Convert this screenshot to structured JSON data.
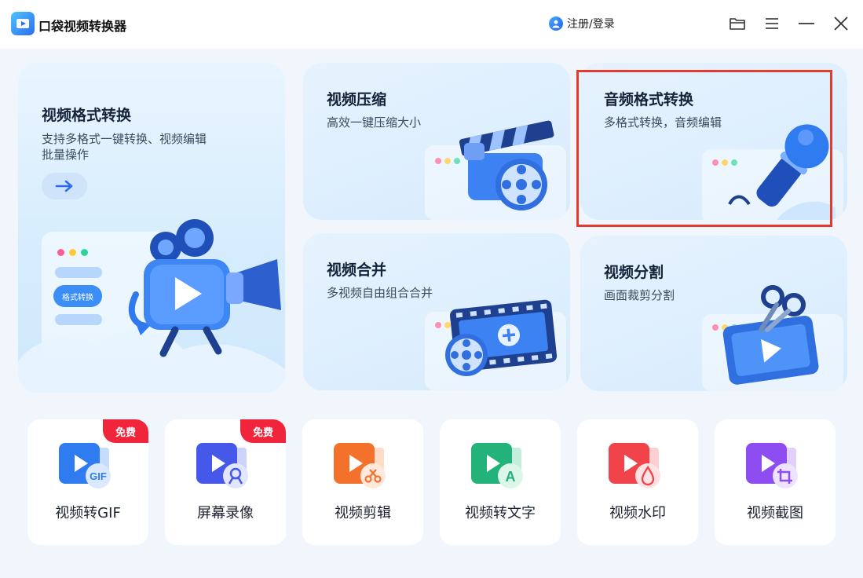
{
  "app": {
    "title": "口袋视频转换器",
    "login_label": "注册/登录"
  },
  "window_controls": [
    "folder-icon",
    "menu-icon",
    "minimize-icon",
    "close-icon"
  ],
  "feature_cards": {
    "format_convert": {
      "title": "视频格式转换",
      "subtitle_line1": "支持多格式一键转换、视频编辑",
      "subtitle_line2": "批量操作",
      "pill_label": "格式转换"
    },
    "compress": {
      "title": "视频压缩",
      "subtitle": "高效一键压缩大小"
    },
    "audio_convert": {
      "title": "音频格式转换",
      "subtitle": "多格式转换，音频编辑",
      "selected": true
    },
    "merge": {
      "title": "视频合并",
      "subtitle": "多视频自由组合合并"
    },
    "split": {
      "title": "视频分割",
      "subtitle": "画面裁剪分割"
    }
  },
  "tools": [
    {
      "label": "视频转GIF",
      "badge": "免费",
      "icon_text": "GIF",
      "color": "#2f7bf0"
    },
    {
      "label": "屏幕录像",
      "badge": "免费",
      "color": "#4558ea"
    },
    {
      "label": "视频剪辑",
      "color": "#f3712b"
    },
    {
      "label": "视频转文字",
      "icon_text": "A",
      "color": "#22b27a"
    },
    {
      "label": "视频水印",
      "color": "#f0444a"
    },
    {
      "label": "视频截图",
      "color": "#8e4df0"
    }
  ],
  "colors": {
    "accent": "#2b6df0",
    "highlight_border": "#e53a2c",
    "badge": "#f0243b",
    "background": "#f1f6fc"
  }
}
